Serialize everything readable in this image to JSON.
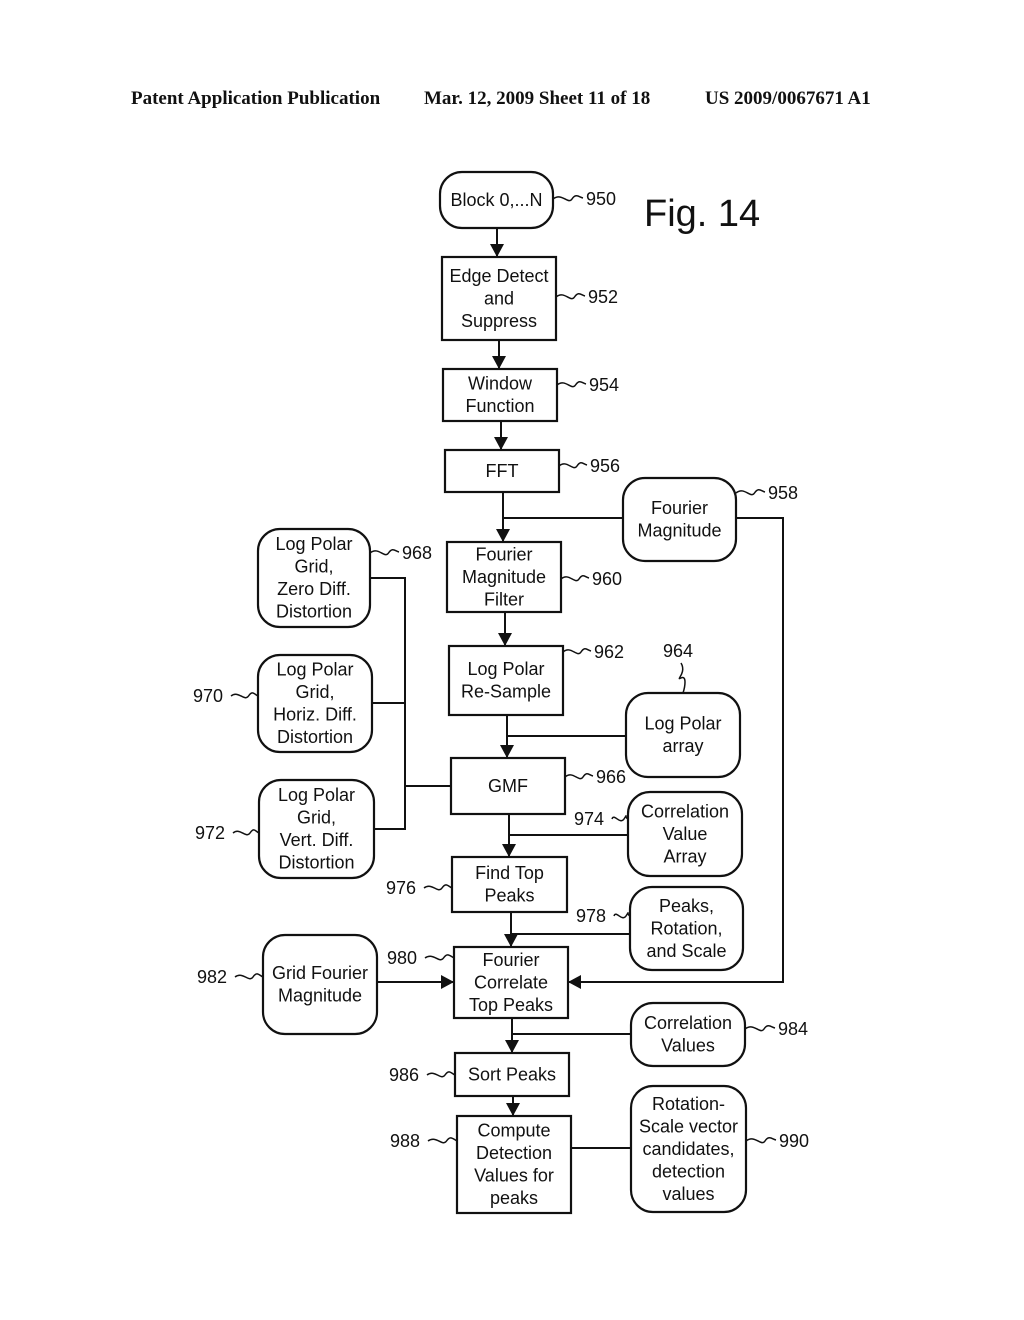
{
  "header": {
    "publication": "Patent Application Publication",
    "date_sheet": "Mar. 12, 2009  Sheet 11 of 18",
    "number": "US 2009/0067671 A1"
  },
  "figure_label": "Fig. 14",
  "nodes": {
    "n950": {
      "lines": [
        "Block 0,...N"
      ],
      "ref": "950",
      "shape": "rounded"
    },
    "n952": {
      "lines": [
        "Edge Detect",
        "and",
        "Suppress"
      ],
      "ref": "952",
      "shape": "rect"
    },
    "n954": {
      "lines": [
        "Window",
        "Function"
      ],
      "ref": "954",
      "shape": "rect"
    },
    "n956": {
      "lines": [
        "FFT"
      ],
      "ref": "956",
      "shape": "rect"
    },
    "n958": {
      "lines": [
        "Fourier",
        "Magnitude"
      ],
      "ref": "958",
      "shape": "rounded"
    },
    "n960": {
      "lines": [
        "Fourier",
        "Magnitude",
        "Filter"
      ],
      "ref": "960",
      "shape": "rect"
    },
    "n962": {
      "lines": [
        "Log Polar",
        "Re-Sample"
      ],
      "ref": "962",
      "shape": "rect"
    },
    "n964": {
      "lines": [
        "Log Polar",
        "array"
      ],
      "ref": "964",
      "shape": "rounded"
    },
    "n966": {
      "lines": [
        "GMF"
      ],
      "ref": "966",
      "shape": "rect"
    },
    "n968": {
      "lines": [
        "Log Polar",
        "Grid,",
        "Zero Diff.",
        "Distortion"
      ],
      "ref": "968",
      "shape": "rounded"
    },
    "n970": {
      "lines": [
        "Log Polar",
        "Grid,",
        "Horiz. Diff.",
        "Distortion"
      ],
      "ref": "970",
      "shape": "rounded"
    },
    "n972": {
      "lines": [
        "Log Polar",
        "Grid,",
        "Vert. Diff.",
        "Distortion"
      ],
      "ref": "972",
      "shape": "rounded"
    },
    "n974": {
      "lines": [
        "Correlation",
        "Value",
        "Array"
      ],
      "ref": "974",
      "shape": "rounded"
    },
    "n976": {
      "lines": [
        "Find Top",
        "Peaks"
      ],
      "ref": "976",
      "shape": "rect"
    },
    "n978": {
      "lines": [
        "Peaks,",
        "Rotation,",
        "and Scale"
      ],
      "ref": "978",
      "shape": "rounded"
    },
    "n980": {
      "lines": [
        "Fourier",
        "Correlate",
        "Top Peaks"
      ],
      "ref": "980",
      "shape": "rect"
    },
    "n982": {
      "lines": [
        "Grid Fourier",
        "Magnitude"
      ],
      "ref": "982",
      "shape": "rounded"
    },
    "n984": {
      "lines": [
        "Correlation",
        "Values"
      ],
      "ref": "984",
      "shape": "rounded"
    },
    "n986": {
      "lines": [
        "Sort Peaks"
      ],
      "ref": "986",
      "shape": "rect"
    },
    "n988": {
      "lines": [
        "Compute",
        "Detection",
        "Values for",
        "peaks"
      ],
      "ref": "988",
      "shape": "rect"
    },
    "n990": {
      "lines": [
        "Rotation-",
        "Scale vector",
        "candidates,",
        "detection",
        "values"
      ],
      "ref": "990",
      "shape": "rounded"
    }
  },
  "edges": [
    {
      "from": "950",
      "to": "952"
    },
    {
      "from": "952",
      "to": "954"
    },
    {
      "from": "954",
      "to": "956"
    },
    {
      "from": "956",
      "to": "960"
    },
    {
      "from": "958",
      "to": "960"
    },
    {
      "from": "958",
      "to": "980"
    },
    {
      "from": "960",
      "to": "962"
    },
    {
      "from": "962",
      "to": "966"
    },
    {
      "from": "964",
      "to": "966"
    },
    {
      "from": "968",
      "to": "966"
    },
    {
      "from": "970",
      "to": "966"
    },
    {
      "from": "972",
      "to": "966"
    },
    {
      "from": "966",
      "to": "976"
    },
    {
      "from": "974",
      "to": "976"
    },
    {
      "from": "976",
      "to": "980"
    },
    {
      "from": "978",
      "to": "980"
    },
    {
      "from": "982",
      "to": "980"
    },
    {
      "from": "980",
      "to": "986"
    },
    {
      "from": "984",
      "to": "986"
    },
    {
      "from": "986",
      "to": "988"
    },
    {
      "from": "988",
      "to": "990"
    }
  ]
}
